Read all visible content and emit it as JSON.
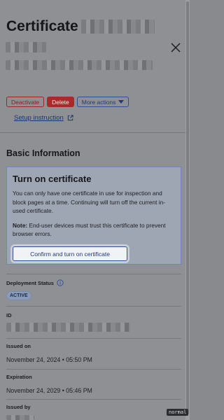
{
  "header": {
    "title": "Certificate",
    "close_icon": "close-icon"
  },
  "actions": {
    "deactivate": "Deactivate",
    "delete": "Delete",
    "more_actions": "More actions",
    "more_actions_icon": "caret-down-icon"
  },
  "setup_link": {
    "label": "Setup instruction",
    "icon": "external-link-icon"
  },
  "basic_info": {
    "section_title": "Basic Information"
  },
  "callout": {
    "title": "Turn on certificate",
    "body": "You can only have one certificate in use for inspection and block pages at a time. Continuing will turn off the current in-used certificate.",
    "note_label": "Note:",
    "note_text": " End-user devices must trust this certificate to prevent browser errors.",
    "confirm_button": "Confirm and turn on certificate"
  },
  "fields": {
    "deployment_status": {
      "label": "Deployment Status",
      "icon": "info-icon",
      "value": "ACTIVE"
    },
    "id": {
      "label": "ID"
    },
    "issued_on": {
      "label": "Issued on",
      "value": "November 24, 2024 • 05:50 PM"
    },
    "expiration": {
      "label": "Expiration",
      "value": "November 24, 2029 • 05:46 PM"
    },
    "issued_by": {
      "label": "Issued by"
    }
  },
  "mode_tag": "normal",
  "colors": {
    "danger": "#a82a2a",
    "accent": "#2f4f96",
    "callout_border": "#6f88b8"
  }
}
